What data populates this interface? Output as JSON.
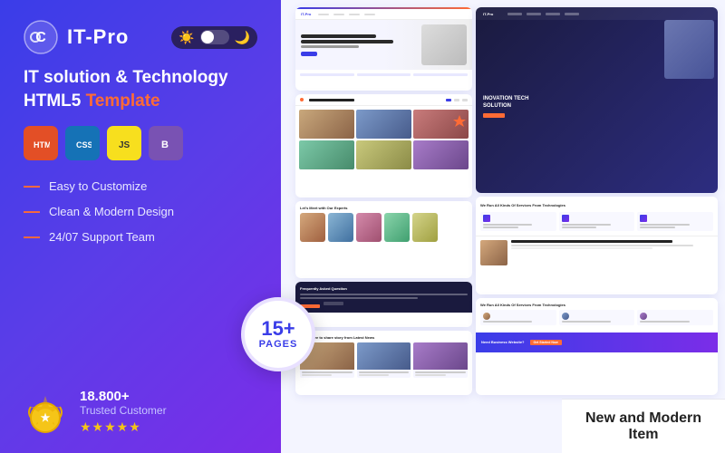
{
  "left": {
    "logo_text": "IT-Pro",
    "headline_line1": "IT solution & Technology",
    "headline_line2": "HTML5",
    "headline_accent": "Template",
    "features": [
      "Easy to Customize",
      "Clean & Modern Design",
      "24/07 Support Team"
    ],
    "customer_count": "18.800+",
    "customer_label": "Trusted Customer",
    "stars": "★★★★★",
    "pages_number": "15+",
    "pages_label": "PAGES",
    "tech_badges": [
      "HTML",
      "CSS",
      "JS",
      "B"
    ]
  },
  "right": {
    "new_item_label": "New and Modern Item"
  }
}
